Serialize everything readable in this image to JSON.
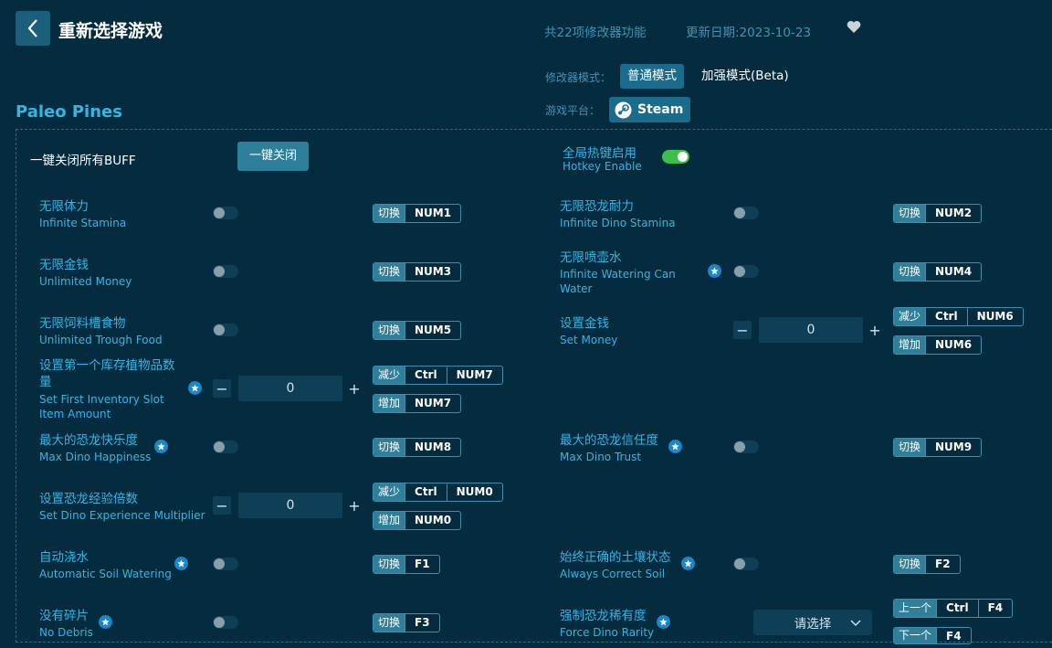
{
  "header": {
    "title": "重新选择游戏",
    "feature_count": "共22项修改器功能",
    "update_date": "更新日期:2023-10-23"
  },
  "mode": {
    "label": "修改器模式：",
    "normal": "普通模式",
    "enhanced": "加强模式(Beta)"
  },
  "platform": {
    "label": "游戏平台：",
    "name": "Steam"
  },
  "game": {
    "name": "Paleo Pines"
  },
  "controls": {
    "disable_all_label": "一键关闭所有BUFF",
    "disable_all_button": "一键关闭",
    "hotkey_cn": "全局热键启用",
    "hotkey_en": "Hotkey Enable"
  },
  "keys": {
    "toggle": "切换",
    "decrease": "减少",
    "increase": "增加",
    "prev": "上一个",
    "next": "下一个",
    "ctrl": "Ctrl"
  },
  "cheats": [
    {
      "cn": "无限体力",
      "en": "Infinite Stamina",
      "key": "NUM1"
    },
    {
      "cn": "无限恐龙耐力",
      "en": "Infinite Dino Stamina",
      "key": "NUM2"
    },
    {
      "cn": "无限金钱",
      "en": "Unlimited Money",
      "key": "NUM3"
    },
    {
      "cn": "无限喷壶水",
      "en1": "Infinite Watering Can",
      "en2": "Water",
      "key": "NUM4"
    },
    {
      "cn": "无限饲料槽食物",
      "en": "Unlimited Trough Food",
      "key": "NUM5"
    },
    {
      "cn": "设置金钱",
      "en": "Set Money",
      "value": "0",
      "dec": "NUM6",
      "inc": "NUM6"
    },
    {
      "cn1": "设置第一个库存植物品数",
      "cn2": "量",
      "en1": "Set First Inventory Slot",
      "en2": "Item Amount",
      "value": "0",
      "dec": "NUM7",
      "inc": "NUM7"
    },
    {
      "cn": "最大的恐龙快乐度",
      "en": "Max Dino Happiness",
      "key": "NUM8"
    },
    {
      "cn": "最大的恐龙信任度",
      "en": "Max Dino Trust",
      "key": "NUM9"
    },
    {
      "cn": "设置恐龙经验倍数",
      "en": "Set Dino Experience Multiplier",
      "value": "0",
      "dec": "NUM0",
      "inc": "NUM0"
    },
    {
      "cn": "自动浇水",
      "en": "Automatic Soil Watering",
      "key": "F1"
    },
    {
      "cn": "始终正确的土壤状态",
      "en": "Always Correct Soil",
      "key": "F2"
    },
    {
      "cn": "没有碎片",
      "en": "No Debris",
      "key": "F3"
    },
    {
      "cn": "强制恐龙稀有度",
      "en": "Force Dino Rarity",
      "select": "请选择",
      "prev": "F4",
      "next": "F4"
    }
  ]
}
